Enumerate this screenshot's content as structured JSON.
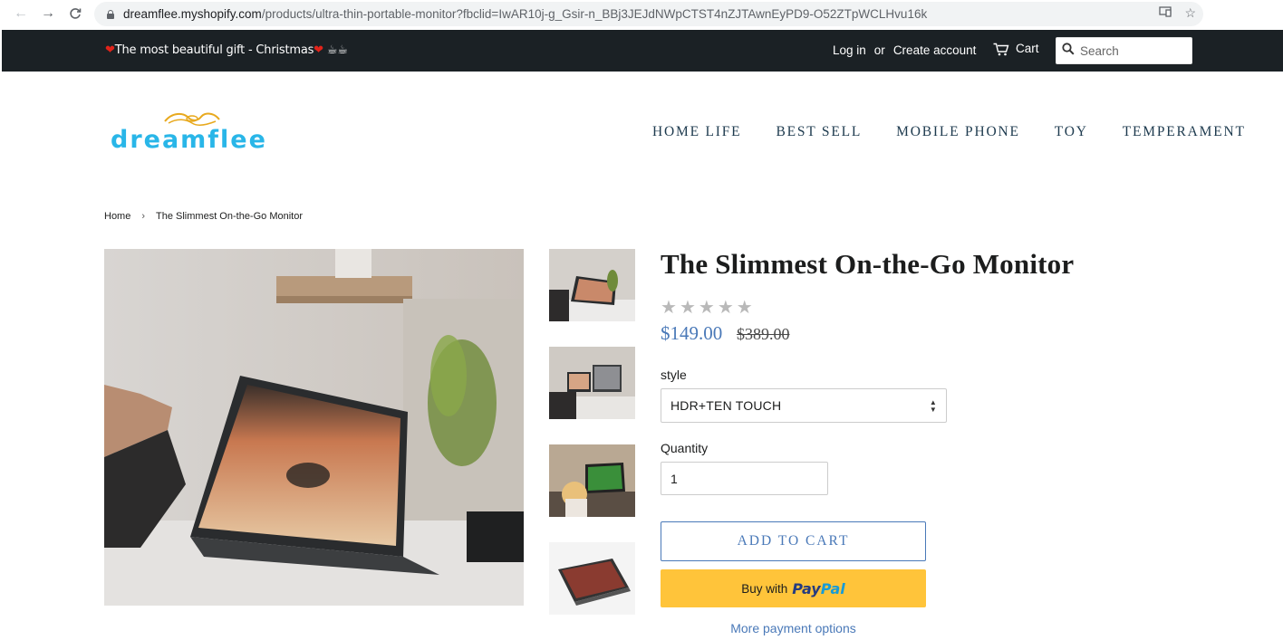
{
  "browser": {
    "url_host": "dreamflee.myshopify.com",
    "url_path": "/products/ultra-thin-portable-monitor?fbclid=IwAR10j-g_Gsir-n_BBj3JEJdNWpCTST4nZJTAwnEyPD9-O52ZTpWCLHvu16k"
  },
  "announcement": {
    "text": "The most beautiful gift - Christmas"
  },
  "account": {
    "login": "Log in",
    "or": "or",
    "create": "Create account"
  },
  "cart": {
    "label": "Cart"
  },
  "search": {
    "placeholder": "Search"
  },
  "logo": {
    "text": "dreamflee"
  },
  "nav": {
    "items": [
      "HOME LIFE",
      "BEST SELL",
      "MOBILE PHONE",
      "TOY",
      "TEMPERAMENT"
    ]
  },
  "breadcrumb": {
    "home": "Home",
    "separator": "›",
    "current": "The Slimmest On-the-Go Monitor"
  },
  "product": {
    "title": "The Slimmest On-the-Go Monitor",
    "rating_stars": 5,
    "price": "$149.00",
    "compare_price": "$389.00",
    "style_label": "style",
    "style_value": "HDR+TEN TOUCH",
    "quantity_label": "Quantity",
    "quantity_value": "1",
    "add_to_cart": "ADD TO CART",
    "paypal_prefix": "Buy with",
    "paypal_pay": "Pay",
    "paypal_pal": "Pal",
    "more_payment": "More payment options"
  },
  "colors": {
    "topbar_bg": "#1b2125",
    "accent": "#4a79b8",
    "paypal_yellow": "#ffc43a",
    "logo_cyan": "#29b6e8",
    "logo_gold": "#e8a91e"
  }
}
